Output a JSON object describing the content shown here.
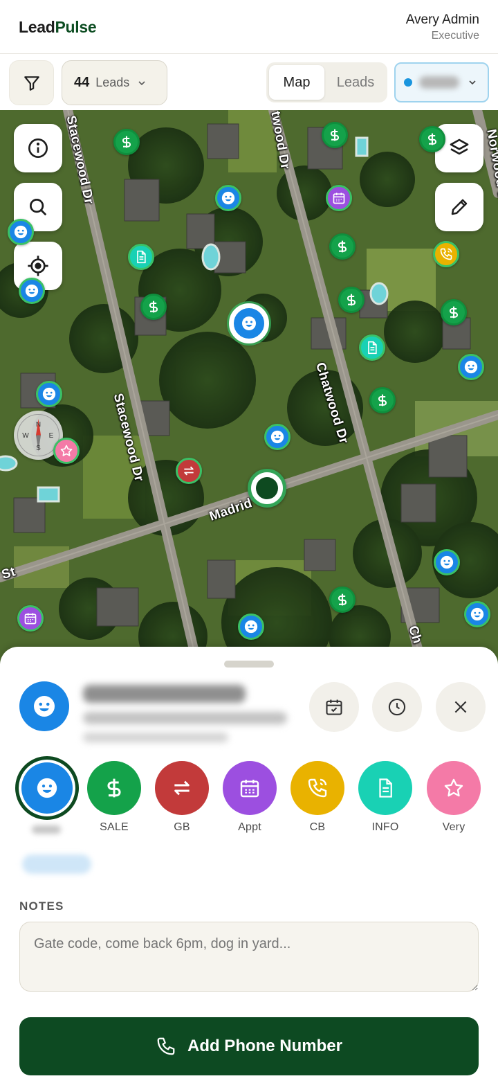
{
  "app": {
    "brand_part1": "Lead",
    "brand_part2": "Pulse"
  },
  "user": {
    "name": "Avery Admin",
    "role": "Executive"
  },
  "toolbar": {
    "leads_count": "44",
    "leads_label": "Leads",
    "view_map": "Map",
    "view_leads": "Leads",
    "team_dot_color": "#1a95de"
  },
  "map": {
    "streets": [
      {
        "id": "stacewood-top",
        "text": "Stacewood Dr"
      },
      {
        "id": "norwood",
        "text": "twood Dr"
      },
      {
        "id": "norwood-right",
        "text": "Norwood Dr"
      },
      {
        "id": "chatwood",
        "text": "Chatwood Dr"
      },
      {
        "id": "stacewood-mid",
        "text": "Stacewood Dr"
      },
      {
        "id": "madrid",
        "text": "Madrid St"
      },
      {
        "id": "st-left",
        "text": "St"
      },
      {
        "id": "ch-bottom",
        "text": "Ch"
      }
    ],
    "controls": [
      "info-icon",
      "search-icon",
      "locate-icon",
      "compass",
      "layers-icon",
      "pencil-icon"
    ]
  },
  "sheet": {
    "statuses": [
      {
        "id": "contacted",
        "label": "",
        "color": "#1a86e5",
        "icon": "smiley-icon"
      },
      {
        "id": "sale",
        "label": "SALE",
        "color": "#14a24a",
        "icon": "dollar-icon"
      },
      {
        "id": "gb",
        "label": "GB",
        "color": "#c23a3a",
        "icon": "swap-icon"
      },
      {
        "id": "appt",
        "label": "Appt",
        "color": "#9c4fe0",
        "icon": "calendar-icon"
      },
      {
        "id": "cb",
        "label": "CB",
        "color": "#e9b200",
        "icon": "phone-callback-icon"
      },
      {
        "id": "info",
        "label": "INFO",
        "color": "#19d1b4",
        "icon": "document-icon"
      },
      {
        "id": "very",
        "label": "Very",
        "color": "#f47aa7",
        "icon": "star-icon"
      }
    ],
    "notes_label": "NOTES",
    "notes_placeholder": "Gate code, come back 6pm, dog in yard...",
    "add_phone_label": "Add Phone Number"
  }
}
